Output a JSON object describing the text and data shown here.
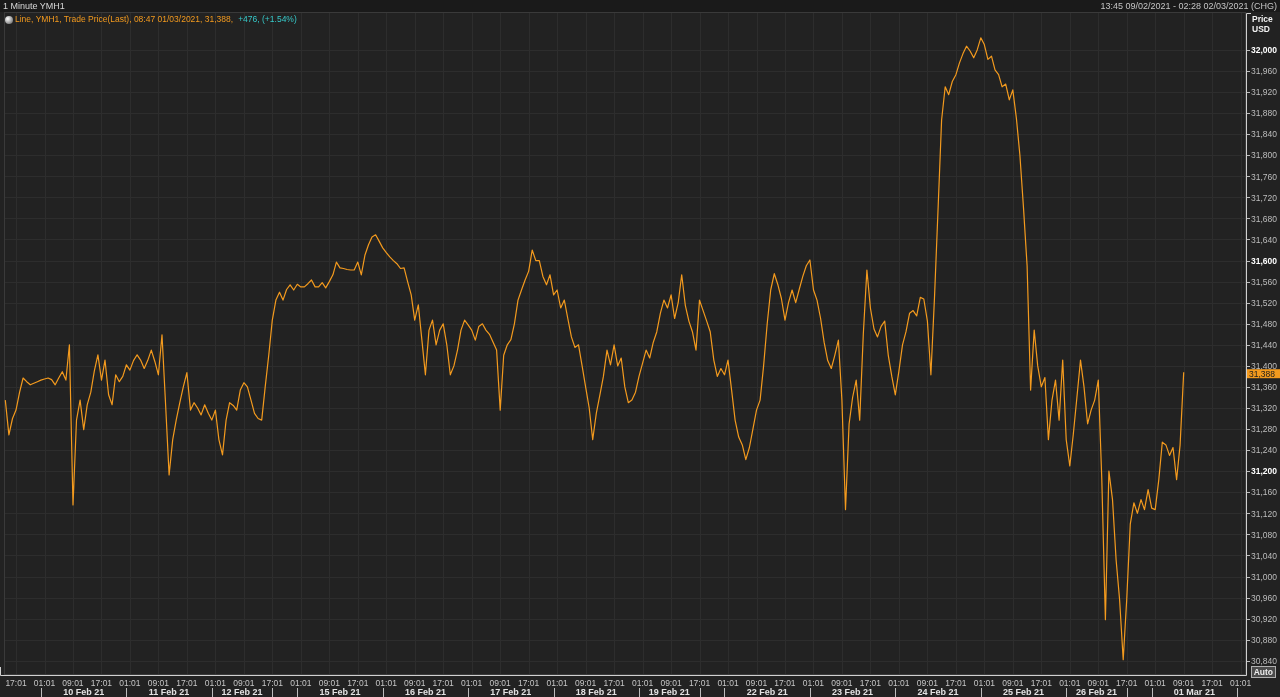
{
  "window": {
    "title": "1 Minute YMH1",
    "range": "13:45 09/02/2021 - 02:28 02/03/2021 (CHG)"
  },
  "chart": {
    "legend_change": "+476, (+1.54%)",
    "axis_button": {
      "label": "Auto"
    },
    "date_axis": [
      {
        "kind": "lead"
      },
      {
        "kind": "day",
        "label": "10 Feb 21"
      },
      {
        "kind": "day",
        "label": "11 Feb 21"
      },
      {
        "kind": "friday",
        "label": "12 Feb 21"
      },
      {
        "kind": "weekend"
      },
      {
        "kind": "day",
        "label": "15 Feb 21"
      },
      {
        "kind": "day",
        "label": "16 Feb 21"
      },
      {
        "kind": "day",
        "label": "17 Feb 21"
      },
      {
        "kind": "day",
        "label": "18 Feb 21"
      },
      {
        "kind": "friday",
        "label": "19 Feb 21"
      },
      {
        "kind": "weekend"
      },
      {
        "kind": "day",
        "label": "22 Feb 21"
      },
      {
        "kind": "day",
        "label": "23 Feb 21"
      },
      {
        "kind": "day",
        "label": "24 Feb 21"
      },
      {
        "kind": "day",
        "label": "25 Feb 21"
      },
      {
        "kind": "friday",
        "label": "26 Feb 21"
      },
      {
        "kind": "weekend"
      },
      {
        "kind": "day",
        "label": "01 Mar 21"
      }
    ],
    "chart_data": {
      "type": "line",
      "ylabel": "Price USD",
      "grid": true,
      "categories": [
        null,
        null,
        null,
        null,
        "17:01",
        null,
        null,
        null,
        null,
        null,
        null,
        null,
        "01:01",
        null,
        null,
        null,
        null,
        null,
        null,
        null,
        "09:01",
        null,
        null,
        null,
        null,
        null,
        null,
        null,
        "17:01",
        null,
        null,
        null,
        null,
        null,
        null,
        null,
        "01:01",
        null,
        null,
        null,
        null,
        null,
        null,
        null,
        "09:01",
        null,
        null,
        null,
        null,
        null,
        null,
        null,
        "17:01",
        null,
        null,
        null,
        null,
        null,
        null,
        null,
        "01:01",
        null,
        null,
        null,
        null,
        null,
        null,
        null,
        "09:01",
        null,
        null,
        null,
        null,
        null,
        null,
        null,
        "17:01",
        null,
        null,
        null,
        null,
        null,
        null,
        null,
        "01:01",
        null,
        null,
        null,
        null,
        null,
        null,
        null,
        "09:01",
        null,
        null,
        null,
        null,
        null,
        null,
        null,
        "17:01",
        null,
        null,
        null,
        null,
        null,
        null,
        null,
        "01:01",
        null,
        null,
        null,
        null,
        null,
        null,
        null,
        "09:01",
        null,
        null,
        null,
        null,
        null,
        null,
        null,
        "17:01",
        null,
        null,
        null,
        null,
        null,
        null,
        null,
        "01:01",
        null,
        null,
        null,
        null,
        null,
        null,
        null,
        "09:01",
        null,
        null,
        null,
        null,
        null,
        null,
        null,
        "17:01",
        null,
        null,
        null,
        null,
        null,
        null,
        null,
        "01:01",
        null,
        null,
        null,
        null,
        null,
        null,
        null,
        "09:01",
        null,
        null,
        null,
        null,
        null,
        null,
        null,
        "17:01",
        null,
        null,
        null,
        null,
        null,
        null,
        null,
        "01:01",
        null,
        null,
        null,
        null,
        null,
        null,
        null,
        "09:01",
        null,
        null,
        null,
        null,
        null,
        null,
        null,
        "17:01",
        null,
        null,
        null,
        null,
        null,
        null,
        null,
        "01:01",
        null,
        null,
        null,
        null,
        null,
        null,
        null,
        "09:01",
        null,
        null,
        null,
        null,
        null,
        null,
        null,
        "17:01",
        null,
        null,
        null,
        null,
        null,
        null,
        null,
        "01:01",
        null,
        null,
        null,
        null,
        null,
        null,
        null,
        "09:01",
        null,
        null,
        null,
        null,
        null,
        null,
        null,
        "17:01",
        null,
        null,
        null,
        null,
        null,
        null,
        null,
        "01:01",
        null,
        null,
        null,
        null,
        null,
        null,
        null,
        "09:01",
        null,
        null,
        null,
        null,
        null,
        null,
        null,
        "17:01",
        null,
        null,
        null,
        null,
        null,
        null,
        null,
        "01:01",
        null,
        null,
        null,
        null,
        null,
        null,
        null,
        "09:01",
        null,
        null,
        null,
        null,
        null,
        null,
        null,
        "17:01",
        null,
        null,
        null,
        null,
        null,
        null,
        null,
        "01:01",
        null,
        null,
        null,
        null,
        null,
        null,
        null,
        "09:01",
        null,
        null,
        null,
        null,
        null,
        null,
        null,
        "17:01",
        null,
        null,
        null,
        null,
        null,
        null,
        null,
        "01:01",
        null,
        null,
        null,
        null,
        null,
        null,
        null,
        "09:01",
        null,
        null,
        null,
        null,
        null,
        null,
        null,
        "17:01",
        null,
        null,
        null,
        null,
        null,
        null,
        null,
        "01:01",
        null
      ],
      "series": [
        {
          "name": "Line, YMH1, Trade Price(Last), 08:47 01/03/2021, 31,388,",
          "color": "#f39a1e",
          "values": [
            null,
            31335,
            31269,
            31300,
            31316,
            31350,
            31377,
            31370,
            31364,
            31367,
            31370,
            31373,
            31375,
            31377,
            31374,
            31364,
            31377,
            31389,
            31373,
            31440,
            31136,
            31297,
            31335,
            31279,
            31326,
            31350,
            31390,
            31421,
            31373,
            31411,
            31345,
            31326,
            31383,
            31370,
            31380,
            31402,
            31392,
            31410,
            31421,
            31411,
            31395,
            31410,
            31430,
            31408,
            31383,
            31459,
            31330,
            31193,
            31260,
            31297,
            31330,
            31360,
            31387,
            31316,
            31330,
            31320,
            31307,
            31326,
            31310,
            31297,
            31316,
            31260,
            31231,
            31297,
            31330,
            31325,
            31316,
            31354,
            31368,
            31360,
            31335,
            31310,
            31300,
            31297,
            31360,
            31421,
            31487,
            31525,
            31540,
            31525,
            31545,
            31554,
            31544,
            31555,
            31550,
            31550,
            31556,
            31563,
            31550,
            31550,
            31558,
            31548,
            31560,
            31573,
            31597,
            31586,
            31585,
            31583,
            31582,
            31582,
            31597,
            31573,
            31610,
            31630,
            31645,
            31649,
            31637,
            31624,
            31615,
            31607,
            31600,
            31594,
            31585,
            31586,
            31560,
            31535,
            31487,
            31516,
            31449,
            31383,
            31468,
            31487,
            31440,
            31468,
            31480,
            31440,
            31383,
            31400,
            31430,
            31468,
            31487,
            31478,
            31468,
            31449,
            31475,
            31480,
            31468,
            31460,
            31445,
            31430,
            31316,
            31420,
            31440,
            31450,
            31480,
            31525,
            31544,
            31563,
            31580,
            31620,
            31600,
            31600,
            31570,
            31554,
            31573,
            31535,
            31544,
            31510,
            31525,
            31490,
            31455,
            31435,
            31440,
            31400,
            31360,
            31320,
            31260,
            31310,
            31345,
            31380,
            31430,
            31402,
            31440,
            31400,
            31415,
            31360,
            31330,
            31335,
            31350,
            31380,
            31405,
            31430,
            31415,
            31445,
            31465,
            31500,
            31525,
            31510,
            31535,
            31490,
            31520,
            31573,
            31515,
            31485,
            31465,
            31430,
            31525,
            31505,
            31485,
            31465,
            31411,
            31380,
            31395,
            31383,
            31411,
            31354,
            31297,
            31265,
            31250,
            31222,
            31245,
            31280,
            31316,
            31335,
            31400,
            31480,
            31544,
            31575,
            31554,
            31528,
            31487,
            31520,
            31544,
            31520,
            31545,
            31570,
            31590,
            31601,
            31544,
            31525,
            31490,
            31445,
            31410,
            31395,
            31420,
            31449,
            31335,
            31127,
            31290,
            31340,
            31373,
            31297,
            31460,
            31582,
            31510,
            31470,
            31455,
            31475,
            31485,
            31421,
            31380,
            31345,
            31390,
            31440,
            31465,
            31500,
            31505,
            31495,
            31530,
            31527,
            31485,
            31383,
            31530,
            31700,
            31867,
            31930,
            31915,
            31940,
            31953,
            31975,
            31993,
            32007,
            31998,
            31985,
            32000,
            32023,
            32010,
            31982,
            31988,
            31962,
            31953,
            31930,
            31935,
            31905,
            31924,
            31870,
            31800,
            31700,
            31590,
            31354,
            31468,
            31400,
            31360,
            31378,
            31260,
            31335,
            31373,
            31297,
            31411,
            31260,
            31210,
            31270,
            31340,
            31411,
            31360,
            31290,
            31316,
            31335,
            31373,
            31184,
            30918,
            31200,
            31146,
            31032,
            30956,
            30842,
            30956,
            31100,
            31140,
            31120,
            31146,
            31127,
            31165,
            31130,
            31127,
            31184,
            31255,
            31250,
            31230,
            31245,
            31184,
            31250,
            31388,
            null,
            null,
            null,
            null,
            null,
            null,
            null,
            null,
            null,
            null,
            null,
            null,
            null,
            null,
            null,
            null,
            null
          ]
        }
      ],
      "ylim": [
        30813,
        32072
      ],
      "yticks": [
        {
          "value": 30840,
          "label": "30,840"
        },
        {
          "value": 30880,
          "label": "30,880"
        },
        {
          "value": 30920,
          "label": "30,920"
        },
        {
          "value": 30960,
          "label": "30,960"
        },
        {
          "value": 31000,
          "label": "31,000"
        },
        {
          "value": 31040,
          "label": "31,040"
        },
        {
          "value": 31080,
          "label": "31,080"
        },
        {
          "value": 31120,
          "label": "31,120"
        },
        {
          "value": 31160,
          "label": "31,160"
        },
        {
          "value": 31200,
          "label": "31,200"
        },
        {
          "value": 31240,
          "label": "31,240"
        },
        {
          "value": 31280,
          "label": "31,280"
        },
        {
          "value": 31320,
          "label": "31,320"
        },
        {
          "value": 31360,
          "label": "31,360"
        },
        {
          "value": 31400,
          "label": "31,400"
        },
        {
          "value": 31440,
          "label": "31,440"
        },
        {
          "value": 31480,
          "label": "31,480"
        },
        {
          "value": 31520,
          "label": "31,520"
        },
        {
          "value": 31560,
          "label": "31,560"
        },
        {
          "value": 31600,
          "label": "31,600"
        },
        {
          "value": 31640,
          "label": "31,640"
        },
        {
          "value": 31680,
          "label": "31,680"
        },
        {
          "value": 31720,
          "label": "31,720"
        },
        {
          "value": 31760,
          "label": "31,760"
        },
        {
          "value": 31800,
          "label": "31,800"
        },
        {
          "value": 31840,
          "label": "31,840"
        },
        {
          "value": 31880,
          "label": "31,880"
        },
        {
          "value": 31920,
          "label": "31,920"
        },
        {
          "value": 31960,
          "label": "31,960"
        },
        {
          "value": 32000,
          "label": "32,000"
        }
      ],
      "annotations": [
        "31,388"
      ]
    }
  }
}
